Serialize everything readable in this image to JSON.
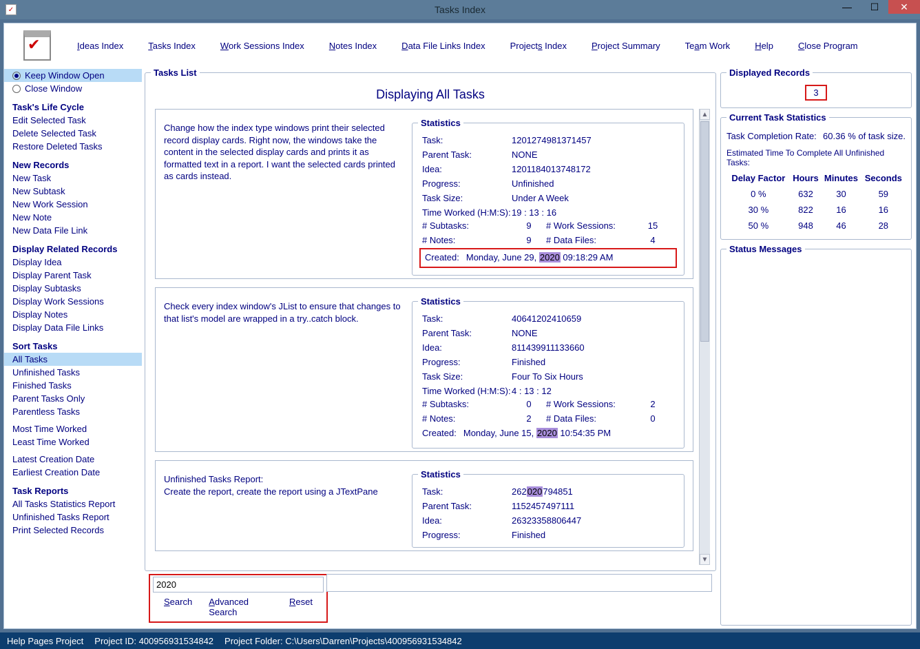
{
  "window_title": "Tasks Index",
  "menu": [
    "Ideas Index",
    "Tasks Index",
    "Work Sessions Index",
    "Notes Index",
    "Data File Links Index",
    "Projects Index",
    "Project Summary",
    "Team Work",
    "Help",
    "Close Program"
  ],
  "menu_underline_idx": [
    0,
    0,
    0,
    0,
    0,
    7,
    0,
    2,
    0,
    0
  ],
  "sidebar": {
    "keep_open": "Keep Window Open",
    "close": "Close Window",
    "groups": [
      {
        "title": "Task's Life Cycle",
        "items": [
          "Edit Selected Task",
          "Delete Selected Task",
          "Restore Deleted Tasks"
        ]
      },
      {
        "title": "New Records",
        "items": [
          "New Task",
          "New Subtask",
          "New Work Session",
          "New Note",
          "New Data File Link"
        ]
      },
      {
        "title": "Display Related Records",
        "items": [
          "Display Idea",
          "Display Parent Task",
          "Display Subtasks",
          "Display Work Sessions",
          "Display Notes",
          "Display Data File Links"
        ]
      },
      {
        "title": "Sort Tasks",
        "items": [
          "All Tasks",
          "Unfinished Tasks",
          "Finished Tasks",
          "Parent Tasks Only",
          "Parentless Tasks"
        ]
      },
      {
        "title": "",
        "items": [
          "Most Time Worked",
          "Least Time Worked"
        ]
      },
      {
        "title": "",
        "items": [
          "Latest Creation Date",
          "Earliest Creation Date"
        ]
      },
      {
        "title": "Task Reports",
        "items": [
          "All Tasks Statistics Report",
          "Unfinished Tasks Report",
          "Print Selected Records"
        ]
      }
    ],
    "selected_sort": "All Tasks"
  },
  "tasks_list_title": "Tasks List",
  "displaying_title": "Displaying All Tasks",
  "stats_legend": "Statistics",
  "labels": {
    "task": "Task:",
    "parent": "Parent Task:",
    "idea": "Idea:",
    "progress": "Progress:",
    "size": "Task Size:",
    "time": "Time Worked (H:M:S):",
    "subtasks": "# Subtasks:",
    "worksessions": "# Work Sessions:",
    "notes": "# Notes:",
    "datafiles": "# Data Files:",
    "created": "Created:"
  },
  "tasks": [
    {
      "desc": "Change how the index type windows print their selected record display cards. Right now, the windows take the content in the selected display cards and prints it as formatted text in a report. I want the selected cards printed as cards instead.",
      "task": "1201274981371457",
      "parent": "NONE",
      "idea": "1201184013748172",
      "progress": "Unfinished",
      "size": "Under A Week",
      "time": "19 : 13 : 16",
      "subtasks": "9",
      "worksessions": "15",
      "notes": "9",
      "datafiles": "4",
      "created_pre": "Monday, June 29, ",
      "created_hl": "2020",
      "created_post": "  09:18:29 AM",
      "created_box": true
    },
    {
      "desc": "Check every index window's JList to ensure that changes to that list's model are wrapped in a try..catch block.",
      "task": "40641202410659",
      "parent": "NONE",
      "idea": "811439911133660",
      "progress": "Finished",
      "size": "Four To Six Hours",
      "time": "4 : 13 : 12",
      "subtasks": "0",
      "worksessions": "2",
      "notes": "2",
      "datafiles": "0",
      "created_pre": "Monday, June 15, ",
      "created_hl": "2020",
      "created_post": "  10:54:35 PM",
      "created_box": false
    },
    {
      "desc_pre": "Unfinished Tasks Report:",
      "desc": "Create the report, create the report using a JTextPane",
      "task_pre": "262",
      "task_hl": "020",
      "task_post": "794851",
      "parent": "1152457497111",
      "idea": "26323358806447",
      "progress": "Finished",
      "partial": true
    }
  ],
  "search": {
    "value": "2020",
    "search": "Search",
    "advanced": "Advanced Search",
    "reset": "Reset"
  },
  "right": {
    "disp_title": "Displayed Records",
    "disp_value": "3",
    "cts_title": "Current Task Statistics",
    "rate_label": "Task Completion Rate:",
    "rate_value": "60.36 % of task size.",
    "est_label": "Estimated Time To Complete All Unfinished Tasks:",
    "cols": [
      "Delay Factor",
      "Hours",
      "Minutes",
      "Seconds"
    ],
    "rows": [
      [
        "0 %",
        "632",
        "30",
        "59"
      ],
      [
        "30 %",
        "822",
        "16",
        "16"
      ],
      [
        "50 %",
        "948",
        "46",
        "28"
      ]
    ],
    "status_title": "Status Messages"
  },
  "footer": {
    "proj": "Help Pages Project",
    "pid_label": "Project ID: ",
    "pid": "400956931534842",
    "folder_label": "Project Folder: ",
    "folder": "C:\\Users\\Darren\\Projects\\400956931534842"
  }
}
